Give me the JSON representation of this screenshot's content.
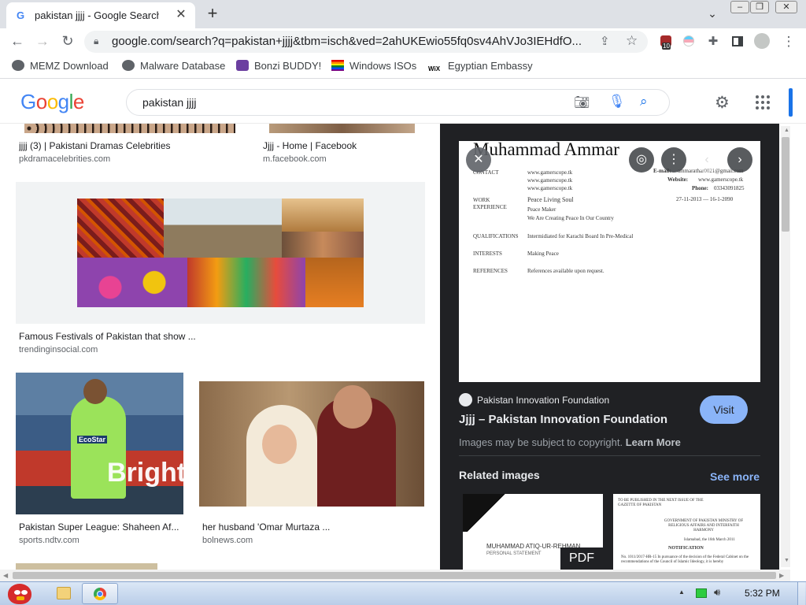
{
  "browser": {
    "tab_title": "pakistan jjjj - Google Search",
    "tab_favicon": "G",
    "url": "google.com/search?q=pakistan+jjjj&tbm=isch&ved=2ahUKEwio55fq0sv4AhVJo3IEHdfO...",
    "extension_badge": "10",
    "bookmarks": [
      {
        "label": "MEMZ Download",
        "icon": "globe-icon"
      },
      {
        "label": "Malware Database",
        "icon": "globe-icon"
      },
      {
        "label": "Bonzi BUDDY!",
        "icon": "bonzi-icon"
      },
      {
        "label": "Windows ISOs",
        "icon": "windows-flag-icon"
      },
      {
        "label": "Egyptian Embassy",
        "icon": "wix-icon"
      }
    ]
  },
  "google": {
    "query": "pakistan jjjj"
  },
  "results": [
    {
      "caption": "jjjj (3) | Pakistani Dramas Celebrities",
      "source": "pkdramacelebrities.com"
    },
    {
      "caption": "Jjjj - Home | Facebook",
      "source": "m.facebook.com"
    },
    {
      "caption": "Famous Festivals of Pakistan that show ...",
      "source": "trendinginsocial.com"
    },
    {
      "caption": "Pakistan Super League: Shaheen Af...",
      "source": "sports.ndtv.com"
    },
    {
      "caption": "her husband 'Omar Murtaza ...",
      "source": "bolnews.com"
    }
  ],
  "thumb_text": {
    "jersey": "EcoStar",
    "banner": "Brighto"
  },
  "preview": {
    "resume": {
      "name": "Muhammad Ammar",
      "contact_label": "CONTACT",
      "contact_lines": [
        "www.gamerscope.tk",
        "www.gamerscope.tk",
        "www.gamerscope.tk"
      ],
      "email_label": "E-mail:",
      "email": "ammarathar0021@gmail.com",
      "website_label": "Website:",
      "website": "www.gamerscope.tk",
      "phone_label": "Phone:",
      "phone": "03343091825",
      "work_label": "WORK EXPERIENCE",
      "work_title": "Peace Living Soul",
      "work_dates": "27-11-2013 — 16-1-2090",
      "work_role": "Peace Maker",
      "work_desc": "We Are Creating Peace In Our Country",
      "qual_label": "QUALIFICATIONS",
      "qual_text": "Intermidiated for Karachi Board In Pre-Medical",
      "interests_label": "INTERESTS",
      "interests_text": "Making Peace",
      "references_label": "REFERENCES",
      "references_text": "References available upon request."
    },
    "site_name": "Pakistan Innovation Foundation",
    "title": "Jjjj – Pakistan Innovation Foundation",
    "visit_label": "Visit",
    "copyright": "Images may be subject to copyright.",
    "learn_more": "Learn More",
    "related_title": "Related images",
    "see_more": "See more",
    "related": [
      {
        "text": "MUHAMMAD ATIQ-UR-REHMAN",
        "sub": "PERSONAL STATEMENT",
        "badge": "PDF"
      },
      {
        "text": "TO BE PUBLISHED IN THE NEXT ISSUE OF THE GAZETTE OF PAKISTAN",
        "sub": "GOVERNMENT OF PAKISTAN MINISTRY OF RELIGIOUS AFFAIRS AND INTERFAITH HARMONY",
        "extra": "Islamabad, the 16th March 2011",
        "heading": "NOTIFICATION",
        "body": "No. 1011/2017-HR-15 In pursuance of the decision of the Federal Cabinet on the recommendations of the Council of Islamic Ideology, it is hereby"
      }
    ]
  },
  "taskbar": {
    "time": "5:32 PM"
  },
  "colors": {
    "accent": "#1a73e8",
    "panel_bg": "#202124",
    "visit_bg": "#8ab4f8",
    "see_more": "#8ab4f8",
    "tab_strip": "#dee1e6"
  }
}
